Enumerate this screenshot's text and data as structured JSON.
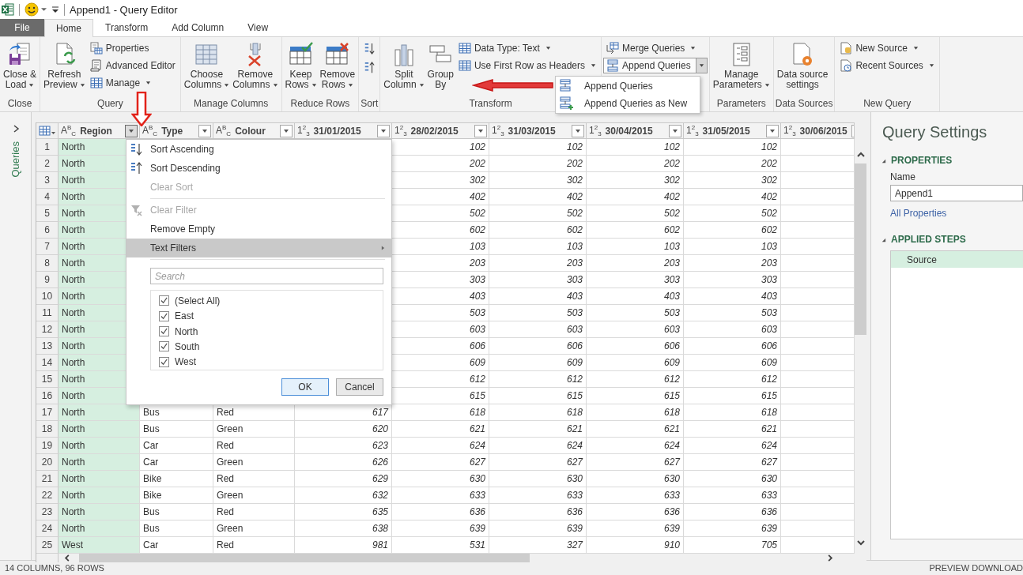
{
  "title_bar": {
    "title": "Append1 - Query Editor"
  },
  "tabs": [
    {
      "label": "File",
      "kind": "file",
      "selected": false
    },
    {
      "label": "Home",
      "kind": "tab",
      "selected": true
    },
    {
      "label": "Transform",
      "kind": "tab",
      "selected": false
    },
    {
      "label": "Add Column",
      "kind": "tab",
      "selected": false
    },
    {
      "label": "View",
      "kind": "tab",
      "selected": false
    }
  ],
  "ribbon": {
    "groups": [
      {
        "label": "Close",
        "large": [
          {
            "lines": [
              "Close &",
              "Load"
            ],
            "dropdown": true
          }
        ]
      },
      {
        "label": "Query",
        "large": [
          {
            "lines": [
              "Refresh",
              "Preview"
            ],
            "dropdown": true
          }
        ],
        "small": [
          {
            "label": "Properties",
            "dropdown": false,
            "open": false
          },
          {
            "label": "Advanced Editor",
            "dropdown": false,
            "open": false
          },
          {
            "label": "Manage",
            "dropdown": true,
            "open": false
          }
        ]
      },
      {
        "label": "Manage Columns",
        "large": [
          {
            "lines": [
              "Choose",
              "Columns"
            ],
            "dropdown": true
          },
          {
            "lines": [
              "Remove",
              "Columns"
            ],
            "dropdown": true
          }
        ]
      },
      {
        "label": "Reduce Rows",
        "large": [
          {
            "lines": [
              "Keep",
              "Rows"
            ],
            "dropdown": true
          },
          {
            "lines": [
              "Remove",
              "Rows"
            ],
            "dropdown": true
          }
        ]
      },
      {
        "label": "Sort",
        "kind": "sort"
      },
      {
        "label": "Transform",
        "large": [
          {
            "lines": [
              "Split",
              "Column"
            ],
            "dropdown": true
          },
          {
            "lines": [
              "Group",
              "By"
            ],
            "dropdown": false
          }
        ],
        "small": [
          {
            "label": "Data Type: Text",
            "dropdown": true,
            "open": false
          },
          {
            "label": "Use First Row as Headers",
            "dropdown": true,
            "open": false
          }
        ]
      },
      {
        "small": [
          {
            "label": "Merge Queries",
            "dropdown": true,
            "open": false
          },
          {
            "label": "Append Queries",
            "dropdown": true,
            "open": true
          }
        ]
      },
      {
        "label": "Parameters",
        "large": [
          {
            "lines": [
              "Manage",
              "Parameters"
            ],
            "dropdown": true
          }
        ]
      },
      {
        "label": "Data Sources",
        "large": [
          {
            "lines": [
              "Data source",
              "settings"
            ],
            "dropdown": false
          }
        ]
      },
      {
        "label": "New Query",
        "small": [
          {
            "label": "New Source",
            "dropdown": true,
            "open": false
          },
          {
            "label": "Recent Sources",
            "dropdown": true,
            "open": false
          }
        ]
      }
    ]
  },
  "append_menu": {
    "items": [
      {
        "label": "Append Queries"
      },
      {
        "label": "Append Queries as New"
      }
    ]
  },
  "queries_pane": {
    "label": "Queries",
    "expanded": false
  },
  "grid": {
    "columns": [
      {
        "type": "A$^{B}$$_{C}$",
        "name": "Region",
        "kind": "text",
        "selected": true,
        "filter_open": true
      },
      {
        "type": "A$^{B}$$_{C}$",
        "name": "Type",
        "kind": "text",
        "selected": false,
        "filter_open": false
      },
      {
        "type": "A$^{B}$$_{C}$",
        "name": "Colour",
        "kind": "text",
        "selected": false,
        "filter_open": false
      },
      {
        "type": "1$^{2}$$_{3}$",
        "name": "31/01/2015",
        "kind": "number",
        "selected": false,
        "filter_open": false
      },
      {
        "type": "1$^{2}$$_{3}$",
        "name": "28/02/2015",
        "kind": "number",
        "selected": false,
        "filter_open": false
      },
      {
        "type": "1$^{2}$$_{3}$",
        "name": "31/03/2015",
        "kind": "number",
        "selected": false,
        "filter_open": false
      },
      {
        "type": "1$^{2}$$_{3}$",
        "name": "30/04/2015",
        "kind": "number",
        "selected": false,
        "filter_open": false
      },
      {
        "type": "1$^{2}$$_{3}$",
        "name": "31/05/2015",
        "kind": "number",
        "selected": false,
        "filter_open": false
      },
      {
        "type": "1$^{2}$$_{3}$",
        "name": "30/06/2015",
        "kind": "number",
        "selected": false,
        "filter_open": false
      }
    ],
    "rows": [
      {
        "num": "1",
        "cells": [
          "North",
          null,
          null,
          null,
          "102",
          "102",
          "102",
          "102"
        ]
      },
      {
        "num": "2",
        "cells": [
          "North",
          null,
          null,
          null,
          "202",
          "202",
          "202",
          "202"
        ]
      },
      {
        "num": "3",
        "cells": [
          "North",
          null,
          null,
          null,
          "302",
          "302",
          "302",
          "302"
        ]
      },
      {
        "num": "4",
        "cells": [
          "North",
          null,
          null,
          null,
          "402",
          "402",
          "402",
          "402"
        ]
      },
      {
        "num": "5",
        "cells": [
          "North",
          null,
          null,
          null,
          "502",
          "502",
          "502",
          "502"
        ]
      },
      {
        "num": "6",
        "cells": [
          "North",
          null,
          null,
          null,
          "602",
          "602",
          "602",
          "602"
        ]
      },
      {
        "num": "7",
        "cells": [
          "North",
          null,
          null,
          null,
          "103",
          "103",
          "103",
          "103"
        ]
      },
      {
        "num": "8",
        "cells": [
          "North",
          null,
          null,
          null,
          "203",
          "203",
          "203",
          "203"
        ]
      },
      {
        "num": "9",
        "cells": [
          "North",
          null,
          null,
          null,
          "303",
          "303",
          "303",
          "303"
        ]
      },
      {
        "num": "10",
        "cells": [
          "North",
          null,
          null,
          null,
          "403",
          "403",
          "403",
          "403"
        ]
      },
      {
        "num": "11",
        "cells": [
          "North",
          null,
          null,
          null,
          "503",
          "503",
          "503",
          "503"
        ]
      },
      {
        "num": "12",
        "cells": [
          "North",
          null,
          null,
          null,
          "603",
          "603",
          "603",
          "603"
        ]
      },
      {
        "num": "13",
        "cells": [
          "North",
          null,
          null,
          null,
          "606",
          "606",
          "606",
          "606"
        ]
      },
      {
        "num": "14",
        "cells": [
          "North",
          null,
          null,
          null,
          "609",
          "609",
          "609",
          "609"
        ]
      },
      {
        "num": "15",
        "cells": [
          "North",
          null,
          null,
          null,
          "612",
          "612",
          "612",
          "612"
        ]
      },
      {
        "num": "16",
        "cells": [
          "North",
          null,
          null,
          null,
          "615",
          "615",
          "615",
          "615"
        ]
      },
      {
        "num": "17",
        "cells": [
          "North",
          "Bus",
          "Red",
          "617",
          "618",
          "618",
          "618",
          "618"
        ]
      },
      {
        "num": "18",
        "cells": [
          "North",
          "Bus",
          "Green",
          "620",
          "621",
          "621",
          "621",
          "621"
        ]
      },
      {
        "num": "19",
        "cells": [
          "North",
          "Car",
          "Red",
          "623",
          "624",
          "624",
          "624",
          "624"
        ]
      },
      {
        "num": "20",
        "cells": [
          "North",
          "Car",
          "Green",
          "626",
          "627",
          "627",
          "627",
          "627"
        ]
      },
      {
        "num": "21",
        "cells": [
          "North",
          "Bike",
          "Red",
          "629",
          "630",
          "630",
          "630",
          "630"
        ]
      },
      {
        "num": "22",
        "cells": [
          "North",
          "Bike",
          "Green",
          "632",
          "633",
          "633",
          "633",
          "633"
        ]
      },
      {
        "num": "23",
        "cells": [
          "North",
          "Bus",
          "Red",
          "635",
          "636",
          "636",
          "636",
          "636"
        ]
      },
      {
        "num": "24",
        "cells": [
          "North",
          "Bus",
          "Green",
          "638",
          "639",
          "639",
          "639",
          "639"
        ]
      },
      {
        "num": "25",
        "cells": [
          "West",
          "Car",
          "Red",
          "981",
          "531",
          "327",
          "910",
          "705"
        ]
      }
    ]
  },
  "filter_menu": {
    "items": [
      {
        "label": "Sort Ascending",
        "disabled": false,
        "selected": false,
        "submenu": false
      },
      {
        "label": "Sort Descending",
        "disabled": false,
        "selected": false,
        "submenu": false
      },
      {
        "label": "Clear Sort",
        "disabled": true,
        "selected": false,
        "submenu": false
      },
      {
        "label": "Clear Filter",
        "disabled": true,
        "selected": false,
        "submenu": false
      },
      {
        "label": "Remove Empty",
        "disabled": false,
        "selected": false,
        "submenu": false
      },
      {
        "label": "Text Filters",
        "disabled": false,
        "selected": true,
        "submenu": true
      }
    ],
    "search": {
      "placeholder": "Search"
    },
    "options": [
      {
        "label": "(Select All)",
        "checked": true
      },
      {
        "label": "East",
        "checked": true
      },
      {
        "label": "North",
        "checked": true
      },
      {
        "label": "South",
        "checked": true
      },
      {
        "label": "West",
        "checked": true
      }
    ],
    "buttons": [
      {
        "label": "OK",
        "default": true
      },
      {
        "label": "Cancel",
        "default": false
      }
    ]
  },
  "query_settings": {
    "title": "Query Settings",
    "properties": {
      "heading": "PROPERTIES",
      "expanded": true,
      "name_label": "Name",
      "name_value": "Append1",
      "link": "All Properties"
    },
    "applied_steps": {
      "heading": "APPLIED STEPS",
      "expanded": true,
      "steps": [
        {
          "label": "Source",
          "selected": true
        }
      ]
    }
  },
  "status_bar": {
    "left": "14 COLUMNS, 96 ROWS",
    "right": "PREVIEW DOWNLOAD"
  }
}
